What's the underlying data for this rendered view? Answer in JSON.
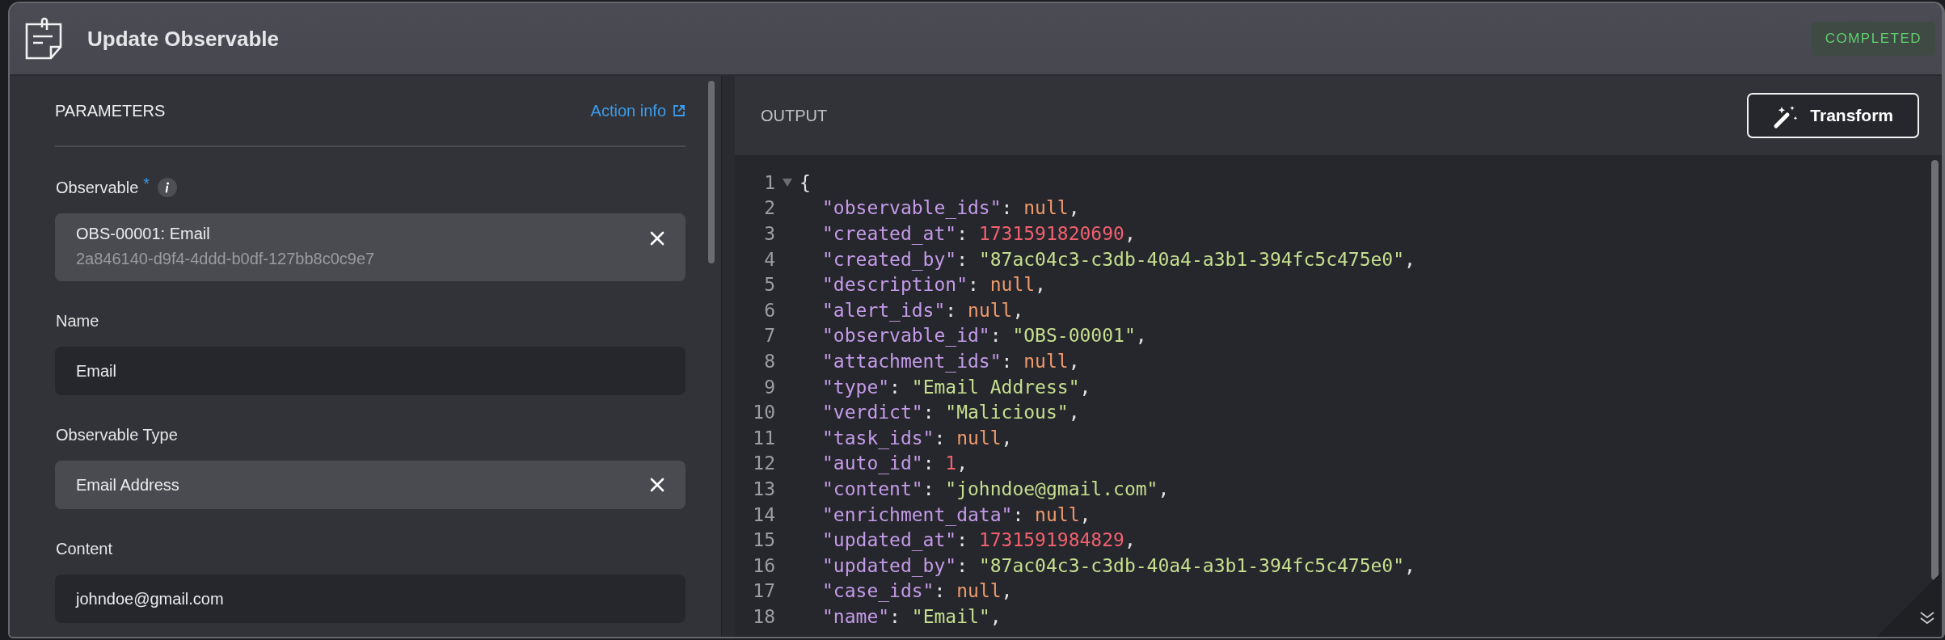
{
  "window": {
    "title": "Update Observable",
    "status": "COMPLETED"
  },
  "parameters": {
    "heading": "PARAMETERS",
    "action_link": "Action info",
    "fields": [
      {
        "kind": "record",
        "label": "Observable",
        "required_mark": "*",
        "info": true,
        "value": "OBS-00001: Email",
        "subtitle": "2a846140-d9f4-4ddd-b0df-127bb8c0c9e7",
        "clearable": true
      },
      {
        "kind": "text",
        "label": "Name",
        "value": "Email"
      },
      {
        "kind": "select",
        "label": "Observable Type",
        "value": "Email Address",
        "clearable": true
      },
      {
        "kind": "text",
        "label": "Content",
        "value": "johndoe@gmail.com"
      }
    ]
  },
  "output": {
    "heading": "OUTPUT",
    "transform_button": "Transform",
    "lines": [
      {
        "number": "1",
        "kind": "brace",
        "expanded": true,
        "tokens": [
          {
            "kind": "punct",
            "text": "{"
          }
        ]
      },
      {
        "number": "2",
        "kind": "member",
        "tokens": [
          {
            "kind": "key",
            "text": "\"observable_ids\""
          },
          {
            "kind": "punct",
            "text": ": "
          },
          {
            "kind": "null",
            "text": "null"
          },
          {
            "kind": "punct",
            "text": ","
          }
        ]
      },
      {
        "number": "3",
        "kind": "member",
        "tokens": [
          {
            "kind": "key",
            "text": "\"created_at\""
          },
          {
            "kind": "punct",
            "text": ": "
          },
          {
            "kind": "number",
            "text": "1731591820690"
          },
          {
            "kind": "punct",
            "text": ","
          }
        ]
      },
      {
        "number": "4",
        "kind": "member",
        "tokens": [
          {
            "kind": "key",
            "text": "\"created_by\""
          },
          {
            "kind": "punct",
            "text": ": "
          },
          {
            "kind": "string",
            "text": "\"87ac04c3-c3db-40a4-a3b1-394fc5c475e0\""
          },
          {
            "kind": "punct",
            "text": ","
          }
        ]
      },
      {
        "number": "5",
        "kind": "member",
        "tokens": [
          {
            "kind": "key",
            "text": "\"description\""
          },
          {
            "kind": "punct",
            "text": ": "
          },
          {
            "kind": "null",
            "text": "null"
          },
          {
            "kind": "punct",
            "text": ","
          }
        ]
      },
      {
        "number": "6",
        "kind": "member",
        "tokens": [
          {
            "kind": "key",
            "text": "\"alert_ids\""
          },
          {
            "kind": "punct",
            "text": ": "
          },
          {
            "kind": "null",
            "text": "null"
          },
          {
            "kind": "punct",
            "text": ","
          }
        ]
      },
      {
        "number": "7",
        "kind": "member",
        "tokens": [
          {
            "kind": "key",
            "text": "\"observable_id\""
          },
          {
            "kind": "punct",
            "text": ": "
          },
          {
            "kind": "string",
            "text": "\"OBS-00001\""
          },
          {
            "kind": "punct",
            "text": ","
          }
        ]
      },
      {
        "number": "8",
        "kind": "member",
        "tokens": [
          {
            "kind": "key",
            "text": "\"attachment_ids\""
          },
          {
            "kind": "punct",
            "text": ": "
          },
          {
            "kind": "null",
            "text": "null"
          },
          {
            "kind": "punct",
            "text": ","
          }
        ]
      },
      {
        "number": "9",
        "kind": "member",
        "tokens": [
          {
            "kind": "key",
            "text": "\"type\""
          },
          {
            "kind": "punct",
            "text": ": "
          },
          {
            "kind": "string",
            "text": "\"Email Address\""
          },
          {
            "kind": "punct",
            "text": ","
          }
        ]
      },
      {
        "number": "10",
        "kind": "member",
        "tokens": [
          {
            "kind": "key",
            "text": "\"verdict\""
          },
          {
            "kind": "punct",
            "text": ": "
          },
          {
            "kind": "string",
            "text": "\"Malicious\""
          },
          {
            "kind": "punct",
            "text": ","
          }
        ]
      },
      {
        "number": "11",
        "kind": "member",
        "tokens": [
          {
            "kind": "key",
            "text": "\"task_ids\""
          },
          {
            "kind": "punct",
            "text": ": "
          },
          {
            "kind": "null",
            "text": "null"
          },
          {
            "kind": "punct",
            "text": ","
          }
        ]
      },
      {
        "number": "12",
        "kind": "member",
        "tokens": [
          {
            "kind": "key",
            "text": "\"auto_id\""
          },
          {
            "kind": "punct",
            "text": ": "
          },
          {
            "kind": "number",
            "text": "1"
          },
          {
            "kind": "punct",
            "text": ","
          }
        ]
      },
      {
        "number": "13",
        "kind": "member",
        "tokens": [
          {
            "kind": "key",
            "text": "\"content\""
          },
          {
            "kind": "punct",
            "text": ": "
          },
          {
            "kind": "string",
            "text": "\"johndoe@gmail.com\""
          },
          {
            "kind": "punct",
            "text": ","
          }
        ]
      },
      {
        "number": "14",
        "kind": "member",
        "tokens": [
          {
            "kind": "key",
            "text": "\"enrichment_data\""
          },
          {
            "kind": "punct",
            "text": ": "
          },
          {
            "kind": "null",
            "text": "null"
          },
          {
            "kind": "punct",
            "text": ","
          }
        ]
      },
      {
        "number": "15",
        "kind": "member",
        "tokens": [
          {
            "kind": "key",
            "text": "\"updated_at\""
          },
          {
            "kind": "punct",
            "text": ": "
          },
          {
            "kind": "number",
            "text": "1731591984829"
          },
          {
            "kind": "punct",
            "text": ","
          }
        ]
      },
      {
        "number": "16",
        "kind": "member",
        "tokens": [
          {
            "kind": "key",
            "text": "\"updated_by\""
          },
          {
            "kind": "punct",
            "text": ": "
          },
          {
            "kind": "string",
            "text": "\"87ac04c3-c3db-40a4-a3b1-394fc5c475e0\""
          },
          {
            "kind": "punct",
            "text": ","
          }
        ]
      },
      {
        "number": "17",
        "kind": "member",
        "tokens": [
          {
            "kind": "key",
            "text": "\"case_ids\""
          },
          {
            "kind": "punct",
            "text": ": "
          },
          {
            "kind": "null",
            "text": "null"
          },
          {
            "kind": "punct",
            "text": ","
          }
        ]
      },
      {
        "number": "18",
        "kind": "member",
        "tokens": [
          {
            "kind": "key",
            "text": "\"name\""
          },
          {
            "kind": "punct",
            "text": ": "
          },
          {
            "kind": "string",
            "text": "\"Email\""
          },
          {
            "kind": "punct",
            "text": ","
          }
        ]
      }
    ]
  }
}
